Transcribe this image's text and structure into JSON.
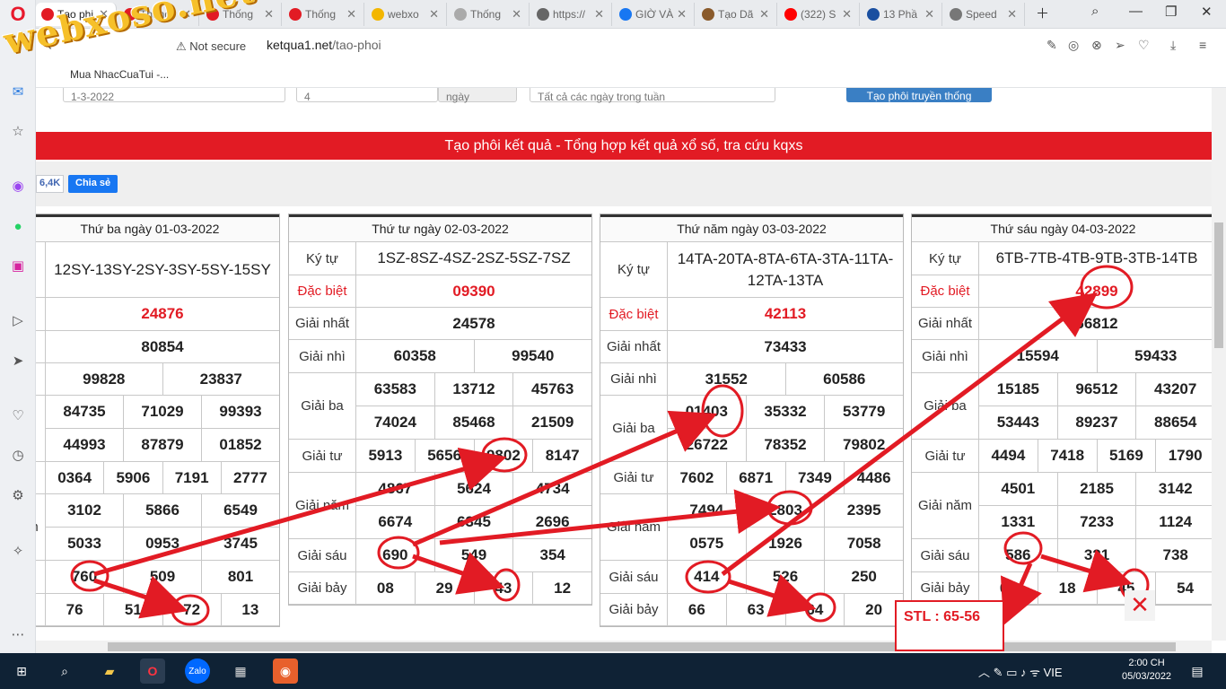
{
  "browser": {
    "tabs": [
      {
        "label": "Tạo phi",
        "color": "#e21b24",
        "active": true
      },
      {
        "label": "Thống",
        "color": "#e21b24"
      },
      {
        "label": "Thống",
        "color": "#e21b24"
      },
      {
        "label": "Thống",
        "color": "#e21b24"
      },
      {
        "label": "webxo",
        "color": "#f3b600"
      },
      {
        "label": "Thống",
        "color": "#aaaaaa"
      },
      {
        "label": "https://",
        "color": "#666666"
      },
      {
        "label": "GIỜ VÀ",
        "color": "#1877f2"
      },
      {
        "label": "Tạo Dã",
        "color": "#8a5a2b"
      },
      {
        "label": "(322) S",
        "color": "#ff0000"
      },
      {
        "label": "13 Phầ",
        "color": "#1a4fa0"
      },
      {
        "label": "Speed",
        "color": "#777777"
      }
    ],
    "not_secure": "Not secure",
    "url_host": "ketqua1.net",
    "url_path": "/tao-phoi",
    "bookmark": "Mua NhacCuaTui -..."
  },
  "watermark": "webxoso.net",
  "page": {
    "banner": "Tạo phôi kết quả - Tổng hợp kết quả xổ số, tra cứu kqxs",
    "fb_count": "6,4K",
    "fb_share": "Chia sẻ",
    "form": {
      "date": "1-3-2022",
      "num": "4",
      "unit": "ngày",
      "select": "Tất cả các ngày trong tuần",
      "button": "Tạo phôi truyền thống"
    }
  },
  "days": [
    {
      "title": "Thứ ba ngày 01-03-2022",
      "rows": [
        {
          "label": "",
          "lines": [
            [
              "12SY-13SY-2SY-3SY-5SY-15SY"
            ]
          ],
          "kind": "code"
        },
        {
          "label": "",
          "lines": [
            [
              "24876"
            ]
          ],
          "kind": "special"
        },
        {
          "label": "t",
          "lines": [
            [
              "80854"
            ]
          ]
        },
        {
          "label": "",
          "lines": [
            [
              "99828",
              "23837"
            ]
          ]
        },
        {
          "label": "",
          "lines": [
            [
              "84735",
              "71029",
              "99393"
            ],
            [
              "44993",
              "87879",
              "01852"
            ]
          ]
        },
        {
          "label": "",
          "lines": [
            [
              "0364",
              "5906",
              "7191",
              "2777"
            ]
          ]
        },
        {
          "label": "m",
          "lines": [
            [
              "3102",
              "5866",
              "6549"
            ],
            [
              "5033",
              "0953",
              "3745"
            ]
          ]
        },
        {
          "label": "",
          "lines": [
            [
              "760",
              "509",
              "801"
            ]
          ]
        },
        {
          "label": "",
          "lines": [
            [
              "76",
              "51",
              "72",
              "13"
            ]
          ]
        }
      ]
    },
    {
      "title": "Thứ tư ngày 02-03-2022",
      "rows": [
        {
          "label": "Ký tự",
          "lines": [
            [
              "1SZ-8SZ-4SZ-2SZ-5SZ-7SZ"
            ]
          ],
          "kind": "code"
        },
        {
          "label": "Đặc biệt",
          "lines": [
            [
              "09390"
            ]
          ],
          "kind": "special"
        },
        {
          "label": "Giải nhất",
          "lines": [
            [
              "24578"
            ]
          ]
        },
        {
          "label": "Giải nhì",
          "lines": [
            [
              "60358",
              "99540"
            ]
          ]
        },
        {
          "label": "Giải ba",
          "lines": [
            [
              "63583",
              "13712",
              "45763"
            ],
            [
              "74024",
              "85468",
              "21509"
            ]
          ]
        },
        {
          "label": "Giải tư",
          "lines": [
            [
              "5913",
              "5656",
              "9802",
              "8147"
            ]
          ]
        },
        {
          "label": "Giải năm",
          "lines": [
            [
              "4867",
              "5624",
              "4734"
            ],
            [
              "6674",
              "6345",
              "2696"
            ]
          ]
        },
        {
          "label": "Giải sáu",
          "lines": [
            [
              "690",
              "549",
              "354"
            ]
          ]
        },
        {
          "label": "Giải bảy",
          "lines": [
            [
              "08",
              "29",
              "43",
              "12"
            ]
          ]
        }
      ]
    },
    {
      "title": "Thứ năm ngày 03-03-2022",
      "rows": [
        {
          "label": "Ký tự",
          "lines": [
            [
              "14TA-20TA-8TA-6TA-3TA-11TA-12TA-13TA"
            ]
          ],
          "kind": "code"
        },
        {
          "label": "Đặc biệt",
          "lines": [
            [
              "42113"
            ]
          ],
          "kind": "special"
        },
        {
          "label": "Giải nhất",
          "lines": [
            [
              "73433"
            ]
          ]
        },
        {
          "label": "Giải nhì",
          "lines": [
            [
              "31552",
              "60586"
            ]
          ]
        },
        {
          "label": "Giải ba",
          "lines": [
            [
              "01403",
              "35332",
              "53779"
            ],
            [
              "26722",
              "78352",
              "79802"
            ]
          ]
        },
        {
          "label": "Giải tư",
          "lines": [
            [
              "7602",
              "6871",
              "7349",
              "4486"
            ]
          ]
        },
        {
          "label": "Giải năm",
          "lines": [
            [
              "7494",
              "2803",
              "2395"
            ],
            [
              "0575",
              "1926",
              "7058"
            ]
          ]
        },
        {
          "label": "Giải sáu",
          "lines": [
            [
              "414",
              "526",
              "250"
            ]
          ]
        },
        {
          "label": "Giải bảy",
          "lines": [
            [
              "66",
              "63",
              "64",
              "20"
            ]
          ]
        }
      ]
    },
    {
      "title": "Thứ sáu ngày 04-03-2022",
      "rows": [
        {
          "label": "Ký tự",
          "lines": [
            [
              "6TB-7TB-4TB-9TB-3TB-14TB"
            ]
          ],
          "kind": "code"
        },
        {
          "label": "Đặc biệt",
          "lines": [
            [
              "42899"
            ]
          ],
          "kind": "special"
        },
        {
          "label": "Giải nhất",
          "lines": [
            [
              "66812"
            ]
          ]
        },
        {
          "label": "Giải nhì",
          "lines": [
            [
              "15594",
              "59433"
            ]
          ]
        },
        {
          "label": "Giải ba",
          "lines": [
            [
              "15185",
              "96512",
              "43207"
            ],
            [
              "53443",
              "89237",
              "88654"
            ]
          ]
        },
        {
          "label": "Giải tư",
          "lines": [
            [
              "4494",
              "7418",
              "5169",
              "1790"
            ]
          ]
        },
        {
          "label": "Giải năm",
          "lines": [
            [
              "4501",
              "2185",
              "3142"
            ],
            [
              "1331",
              "7233",
              "1124"
            ]
          ]
        },
        {
          "label": "Giải sáu",
          "lines": [
            [
              "586",
              "321",
              "738"
            ]
          ]
        },
        {
          "label": "Giải bảy",
          "lines": [
            [
              "08",
              "18",
              "45",
              "54"
            ]
          ]
        }
      ]
    }
  ],
  "annotation": {
    "stl": "STL : 65-56",
    "color": "#e21b24"
  },
  "taskbar": {
    "lang": "VIE",
    "time": "2:00 CH",
    "date": "05/03/2022"
  }
}
